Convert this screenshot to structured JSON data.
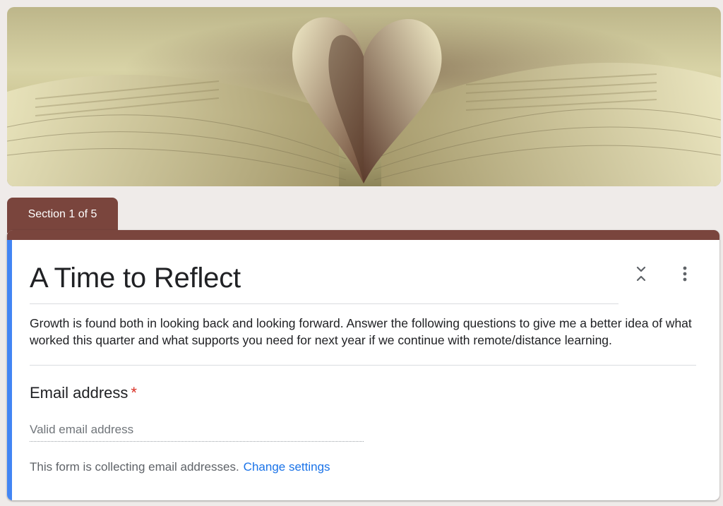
{
  "banner": {
    "image": "open-book-heart-pages-photo"
  },
  "section": {
    "label": "Section 1 of 5"
  },
  "form": {
    "title": "A Time to Reflect",
    "description": "Growth is found both in looking back and looking forward. Answer the following questions to give me a better idea of what worked this quarter and what supports you need for next year if we continue with remote/distance learning."
  },
  "icons": {
    "collapse": "collapse-section-icon",
    "more": "more-vert-icon"
  },
  "question": {
    "title": "Email address",
    "required_marker": "*",
    "placeholder": "Valid email address"
  },
  "footer": {
    "note": "This form is collecting email addresses.",
    "link": "Change settings"
  },
  "colors": {
    "theme": "#7a453d",
    "accent": "#4285f4",
    "link": "#1a73e8",
    "required": "#d93025",
    "background": "#efebe9"
  }
}
